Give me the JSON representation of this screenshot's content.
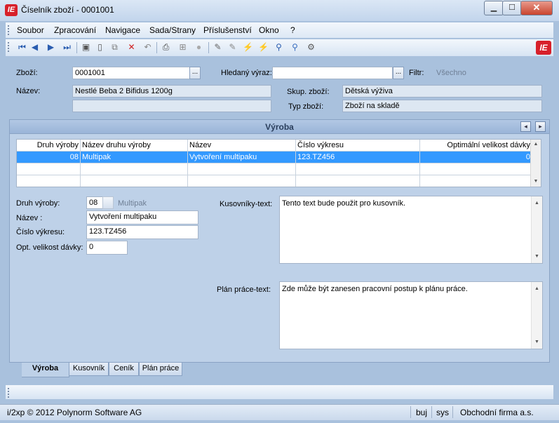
{
  "window": {
    "title": "Číselník zboží - 0001001",
    "logo": "IE",
    "min_label": "▁",
    "max_label": "☐",
    "close_label": "✕"
  },
  "menu": [
    "Soubor",
    "Zpracování",
    "Navigace",
    "Sada/Strany",
    "Příslušenství",
    "Okno",
    "?"
  ],
  "toolbar": {
    "icons": [
      {
        "name": "first-record-icon",
        "glyph": "⏮",
        "color": "#2a5db0"
      },
      {
        "name": "prev-record-icon",
        "glyph": "◀",
        "color": "#2a5db0"
      },
      {
        "name": "next-record-icon",
        "glyph": "▶",
        "color": "#2a5db0"
      },
      {
        "name": "last-record-icon",
        "glyph": "⏭",
        "color": "#2a5db0"
      },
      {
        "name": "save-icon",
        "glyph": "▣",
        "color": "#555555"
      },
      {
        "name": "new-icon",
        "glyph": "▯",
        "color": "#555555"
      },
      {
        "name": "copy-icon",
        "glyph": "⧉",
        "color": "#777777"
      },
      {
        "name": "delete-icon",
        "glyph": "✕",
        "color": "#d01c1c"
      },
      {
        "name": "undo-icon",
        "glyph": "↶",
        "color": "#888888"
      },
      {
        "name": "print-icon",
        "glyph": "⎙",
        "color": "#444444"
      },
      {
        "name": "tree-icon",
        "glyph": "⊞",
        "color": "#888888"
      },
      {
        "name": "disabled-icon",
        "glyph": "●",
        "color": "#aaaaaa"
      },
      {
        "name": "edit-icon",
        "glyph": "✎",
        "color": "#666666"
      },
      {
        "name": "edit-alt-icon",
        "glyph": "✎",
        "color": "#888888"
      },
      {
        "name": "filter-icon",
        "glyph": "⚡",
        "color": "#c9a400"
      },
      {
        "name": "clear-filter-icon",
        "glyph": "⚡",
        "color": "#c93a00"
      },
      {
        "name": "find-icon",
        "glyph": "⚲",
        "color": "#2a5db0"
      },
      {
        "name": "find-next-icon",
        "glyph": "⚲",
        "color": "#3a6fc0"
      },
      {
        "name": "tools-icon",
        "glyph": "⚙",
        "color": "#555555"
      }
    ],
    "brand": "IE"
  },
  "header": {
    "zbozi_label": "Zboží:",
    "zbozi_value": "0001001",
    "hledany_label": "Hledaný výraz:",
    "hledany_value": "",
    "filtr_label": "Filtr:",
    "filtr_value": "Všechno",
    "nazev_label": "Název:",
    "nazev_value": "Nestlé Beba 2 Bifidus 1200g",
    "nazev2_value": "",
    "skup_label": "Skup. zboží:",
    "skup_value": "Dětská výživa",
    "typ_label": "Typ zboží:",
    "typ_value": "Zboží na skladě",
    "dots": "..."
  },
  "section": {
    "title": "Výroba",
    "prev": "◂",
    "next": "▸"
  },
  "grid": {
    "columns": [
      "Druh výroby",
      "Název druhu výroby",
      "Název",
      "Číslo výkresu",
      "Optimální velikost dávky"
    ],
    "rows": [
      [
        "08",
        "Multipak",
        "Vytvoření multipaku",
        "123.TZ456",
        "0"
      ],
      [
        "",
        "",
        "",
        "",
        ""
      ],
      [
        "",
        "",
        "",
        "",
        ""
      ]
    ],
    "scroll_up": "▲",
    "scroll_down": "▼"
  },
  "detail": {
    "druh_label": "Druh výroby:",
    "druh_value": "08",
    "druh_name": "Multipak",
    "nazev_label": "Název    :",
    "nazev_value": "Vytvoření multipaku",
    "cislo_label": "Číslo výkresu:",
    "cislo_value": "123.TZ456",
    "opt_label": "Opt. velikost dávky:",
    "opt_value": "0",
    "kusovniky_label": "Kusovníky-text:",
    "kusovniky_value": "Tento text bude použit pro kusovník.",
    "plan_label": "Plán práce-text:",
    "plan_value": "Zde může být zanesen pracovní postup k plánu práce."
  },
  "tabs": [
    "Výroba",
    "Kusovník",
    "Ceník",
    "Plán práce"
  ],
  "status": {
    "copyright": "i/2xp © 2012 Polynorm Software AG",
    "user": "buj",
    "db": "sys",
    "company": "Obchodní firma a.s."
  }
}
